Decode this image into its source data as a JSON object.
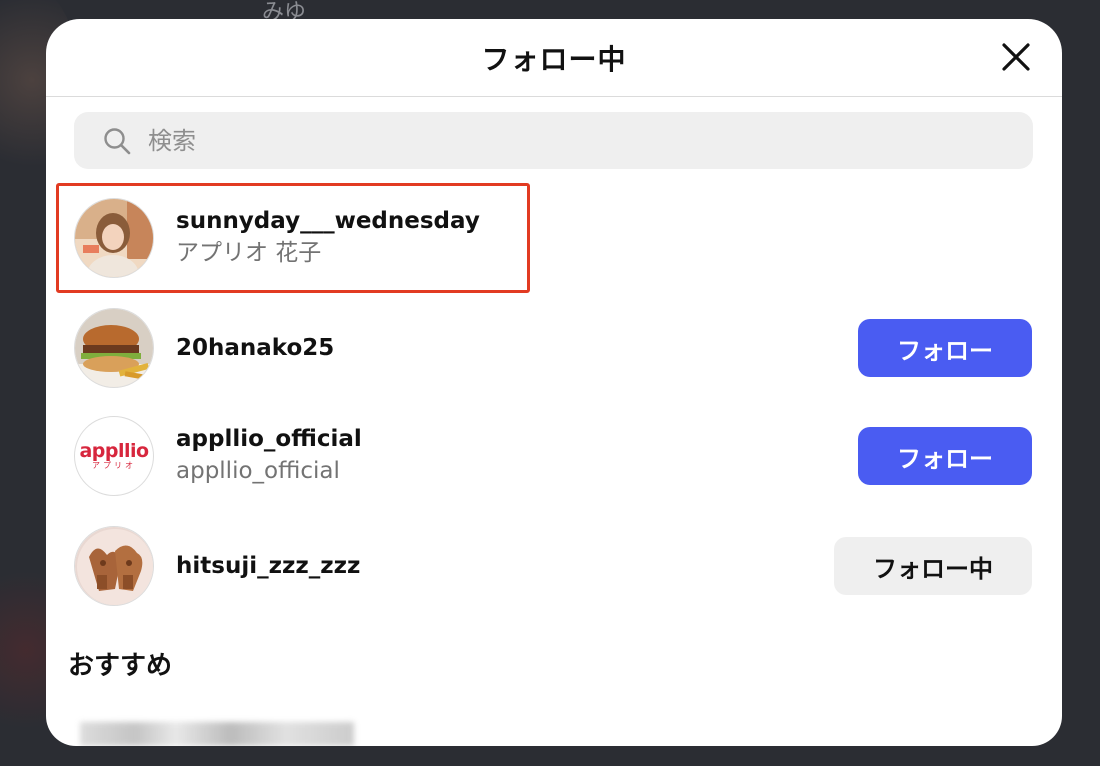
{
  "background": {
    "partial_text": "みゆ"
  },
  "modal": {
    "title": "フォロー中",
    "search_placeholder": "検索",
    "section_title": "おすすめ"
  },
  "users": [
    {
      "username": "sunnyday___wednesday",
      "fullname": "アプリオ 花子",
      "button": "",
      "avatar": "portrait-photo",
      "highlighted": true
    },
    {
      "username": "20hanako25",
      "fullname": "",
      "button": "フォロー",
      "avatar": "burger-photo"
    },
    {
      "username": "appllio_official",
      "fullname": "appllio_official",
      "button": "フォロー",
      "avatar": "appllio-logo",
      "logo_text": "appllio",
      "logo_sub": "アプリオ"
    },
    {
      "username": "hitsuji_zzz_zzz",
      "fullname": "",
      "button": "フォロー中",
      "avatar": "cookie-photo"
    }
  ],
  "colors": {
    "accent": "#4a5cf2",
    "highlight": "#e23b22",
    "brand_red": "#d7263d"
  }
}
